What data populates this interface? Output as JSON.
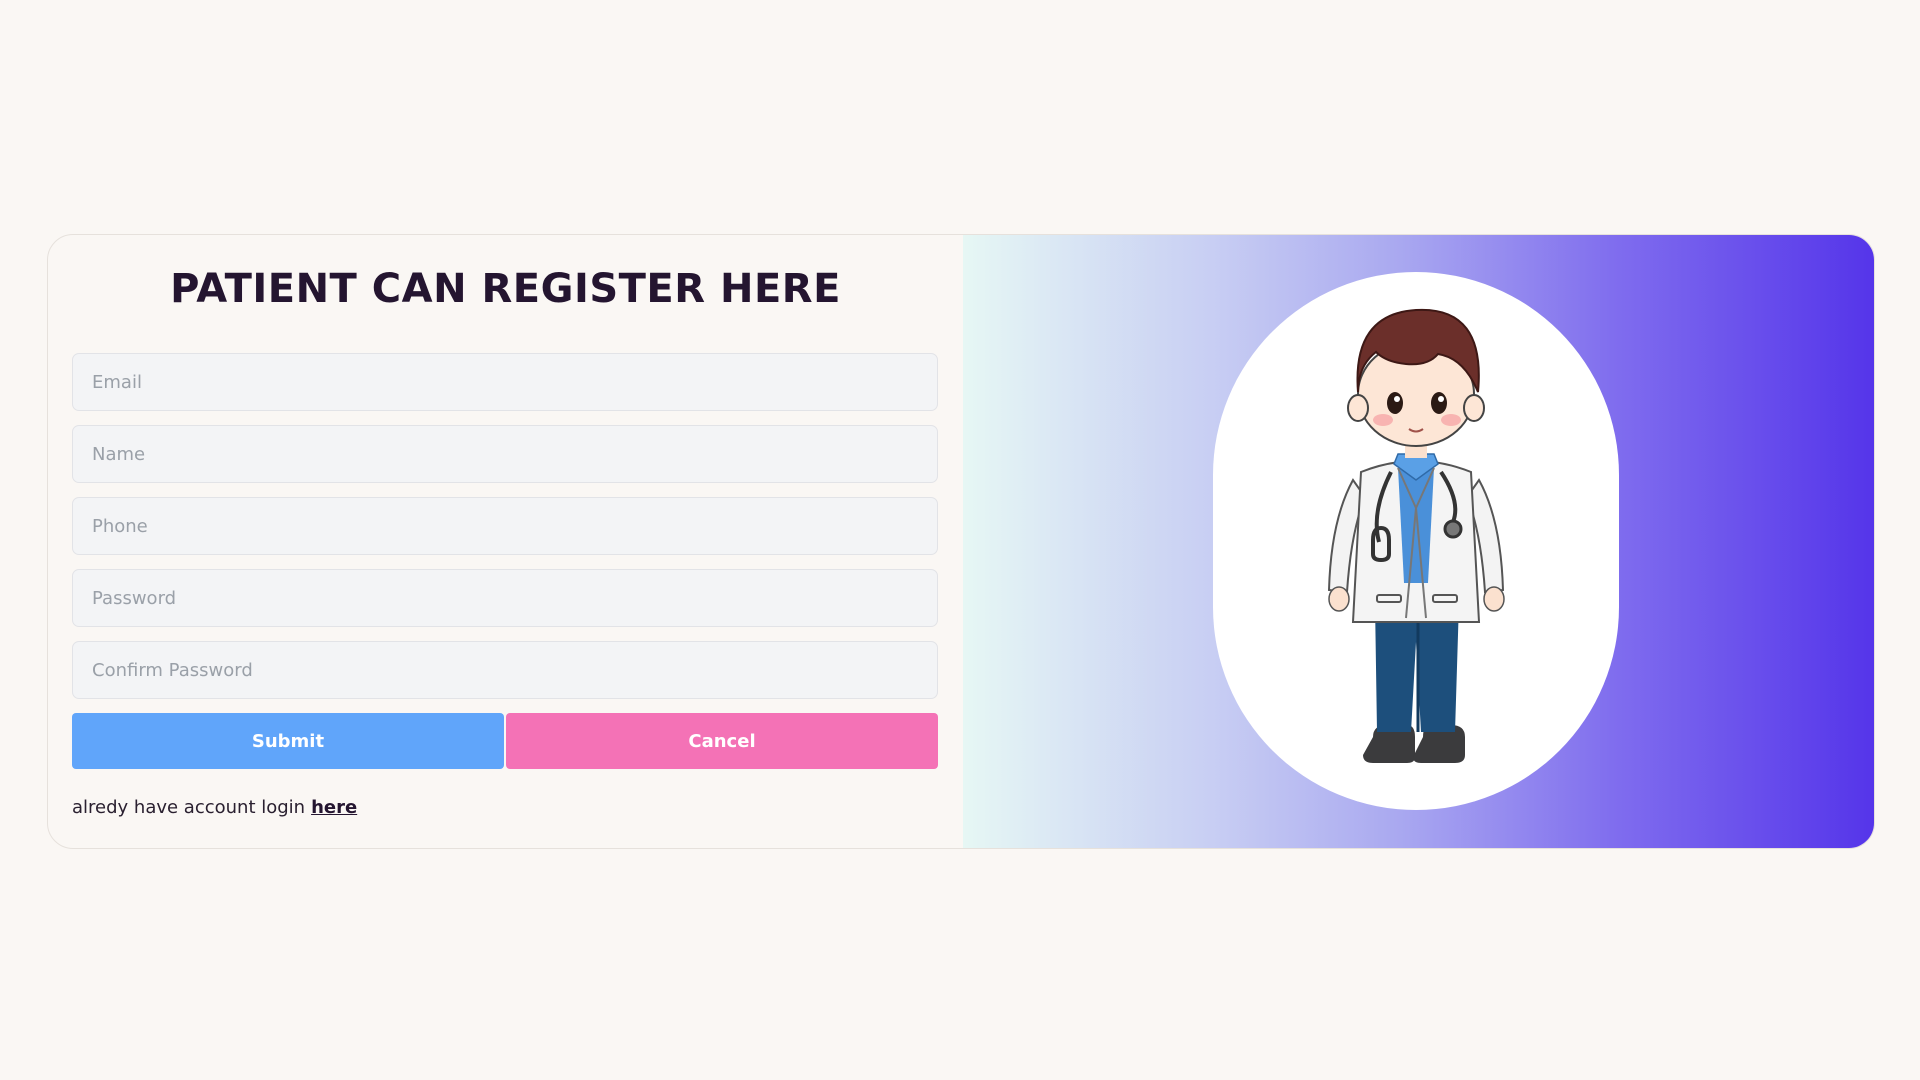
{
  "form": {
    "title": "PATIENT CAN REGISTER HERE",
    "fields": {
      "email_placeholder": "Email",
      "name_placeholder": "Name",
      "phone_placeholder": "Phone",
      "password_placeholder": "Password",
      "confirm_password_placeholder": "Confirm Password"
    },
    "submit_label": "Submit",
    "cancel_label": "Cancel",
    "login_prompt": "alredy have account login",
    "login_link": "here"
  },
  "illustration": {
    "icon": "doctor-illustration",
    "colors": {
      "gradient_start": "#e6f7f4",
      "gradient_end": "#5535ea",
      "submit": "#60a5fa",
      "cancel": "#f472b6"
    }
  }
}
